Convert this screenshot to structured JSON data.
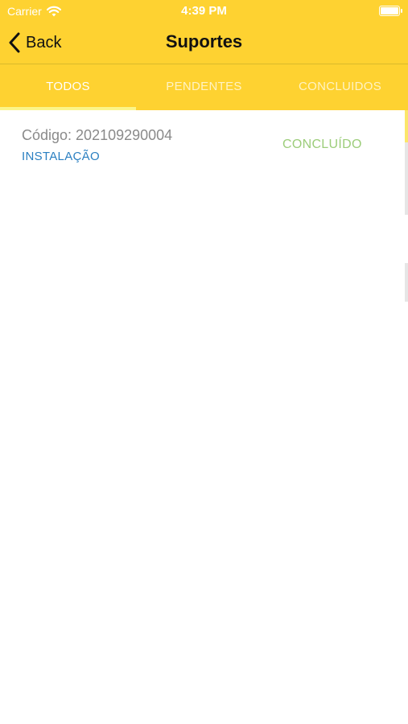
{
  "status_bar": {
    "carrier": "Carrier",
    "time": "4:39 PM"
  },
  "nav": {
    "back_label": "Back",
    "title": "Suportes"
  },
  "tabs": [
    {
      "label": "TODOS",
      "active": true
    },
    {
      "label": "PENDENTES",
      "active": false
    },
    {
      "label": "CONCLUIDOS",
      "active": false
    }
  ],
  "items": [
    {
      "code": "Código: 202109290004",
      "type": "INSTALAÇÃO",
      "status": "CONCLUÍDO"
    }
  ],
  "colors": {
    "header_bg": "#fed231",
    "tab_indicator": "#fbf58a",
    "type_text": "#2a7fc1",
    "status_done": "#9ccd7a",
    "code_text": "#8a8a8a"
  },
  "icons": {
    "back": "chevron-left-icon",
    "wifi": "wifi-icon",
    "battery": "battery-icon"
  }
}
